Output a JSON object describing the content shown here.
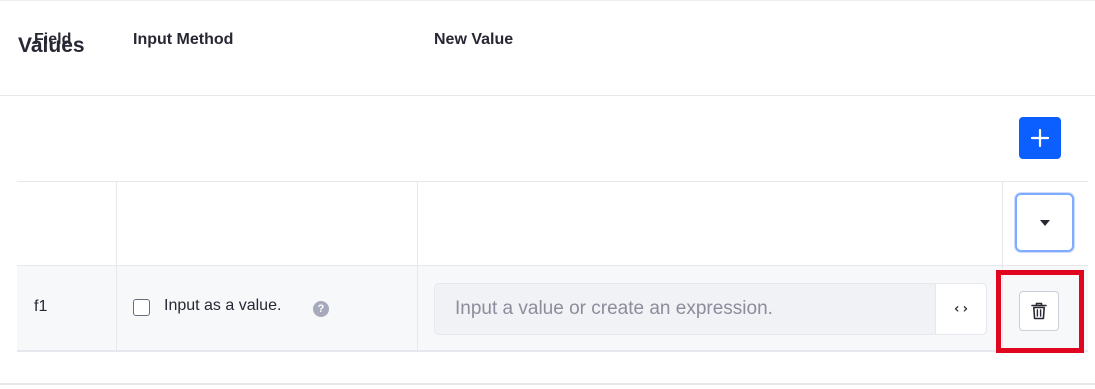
{
  "section": {
    "title": "Values"
  },
  "toolbar": {
    "add_icon": "plus-icon"
  },
  "table": {
    "columns": [
      "Field",
      "Input Method",
      "New Value"
    ],
    "header_menu_icon": "caret-down-icon",
    "rows": [
      {
        "field": "f1",
        "input_method_label": "Input as a value.",
        "input_as_value_checked": false,
        "help_icon_glyph": "?",
        "new_value": "",
        "new_value_placeholder": "Input a value or create an expression.",
        "expression_button_label": "‹›",
        "delete_icon": "trash-icon"
      }
    ]
  },
  "annotation": {
    "highlight_color": "#e1061f"
  },
  "colors": {
    "accent": "#0b5fff",
    "row_background": "#f7f8f9"
  }
}
